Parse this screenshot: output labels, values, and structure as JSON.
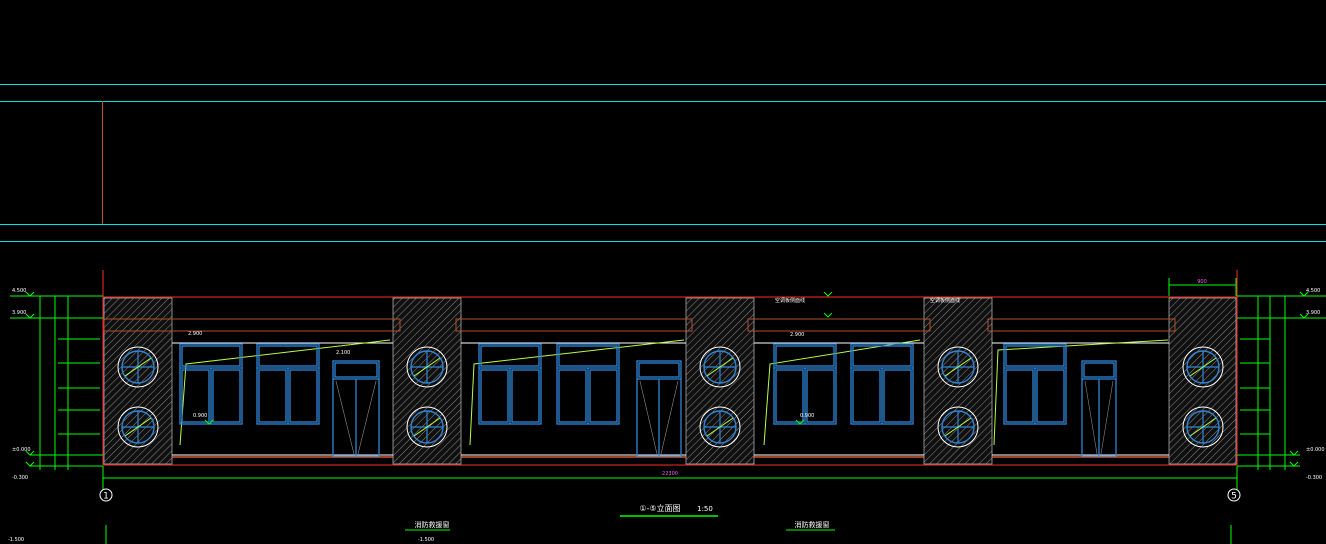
{
  "drawing": {
    "title": "①-⑤立面图",
    "scale": "1:50",
    "axis_start": "1",
    "axis_end": "5",
    "overall_dim": "22300",
    "bottom_notes": [
      "消防救援窗",
      "消防救援窗"
    ],
    "bottom_left_level": "-1.500",
    "bottom_note_level": "-1.500",
    "top_dim": "900",
    "callouts": [
      "空调板侧面线",
      "空调板侧面线"
    ],
    "left_levels": [
      "4.500",
      "3.900",
      "±0.000",
      "-0.300"
    ],
    "right_levels": [
      "4.500",
      "3.900",
      "±0.000",
      "-0.300"
    ],
    "window_levels": [
      "2.900",
      "0.900",
      "2.100"
    ],
    "colors": {
      "background": "#000000",
      "cyan": "#00e5e5",
      "green": "#00ff00",
      "red": "#ff2a2a",
      "brown": "#b0502a",
      "blue": "#2f86d8",
      "white": "#ffffff",
      "magenta": "#ff55ff",
      "hatch": "#9a9a9a"
    }
  }
}
